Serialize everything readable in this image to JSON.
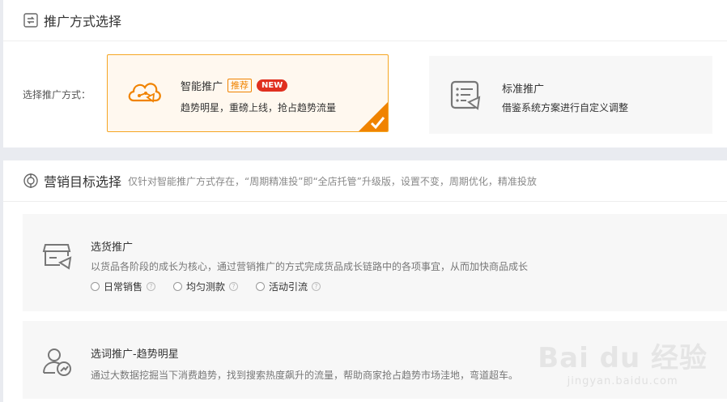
{
  "section1": {
    "title": "推广方式选择",
    "row_label": "选择推广方式：",
    "smart": {
      "title": "智能推广",
      "tag_recommend": "推荐",
      "tag_new": "NEW",
      "subtitle": "趋势明星，重磅上线，抢占趋势流量"
    },
    "standard": {
      "title": "标准推广",
      "subtitle": "借鉴系统方案进行自定义调整"
    }
  },
  "section2": {
    "title": "营销目标选择",
    "desc": "仅针对智能推广方式存在，“周期精准投”即“全店托管”升级版，设置不变，周期优化，精准投放",
    "goal1": {
      "title": "选货推广",
      "desc": "以货品各阶段的成长为核心，通过营销推广的方式完成货品成长链路中的各项事宜，从而加快商品成长",
      "options": [
        "日常销售",
        "均匀测款",
        "活动引流"
      ]
    },
    "goal2": {
      "title": "选词推广-趋势明星",
      "desc": "通过大数据挖掘当下消费趋势，找到搜索热度飙升的流量，帮助商家抢占趋势市场洼地，弯道超车。"
    }
  },
  "watermark": {
    "main": "Bai du 经验",
    "sub": "jingyan.baidu.com"
  },
  "colors": {
    "accent": "#f08300",
    "selected_border": "#f5a623",
    "new_badge": "#e03020"
  }
}
